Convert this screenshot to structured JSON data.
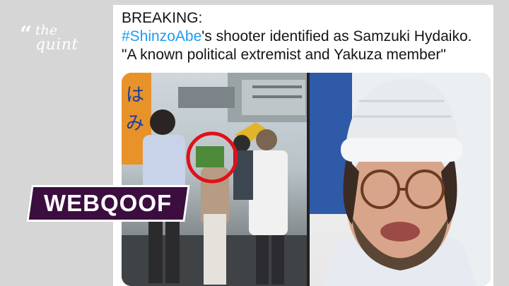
{
  "brand": {
    "quote_glyph": "“",
    "line1": "the",
    "line2": "quint"
  },
  "tweet": {
    "heading": "BREAKING:",
    "hashtag": "#ShinzoAbe",
    "line2_rest": "'s shooter identified as Samzuki Hydaiko.",
    "line3": "\"A known political extremist and Yakuza member\""
  },
  "badge": {
    "label": "WEBQOOF"
  },
  "colors": {
    "hashtag": "#1d9bf0",
    "badge_bg": "#3b0e3f",
    "highlight_circle": "#e0101a",
    "page_bg": "#d6d6d6"
  },
  "images": {
    "left": "crowd-photo",
    "right": "selfie-man-beanie"
  }
}
